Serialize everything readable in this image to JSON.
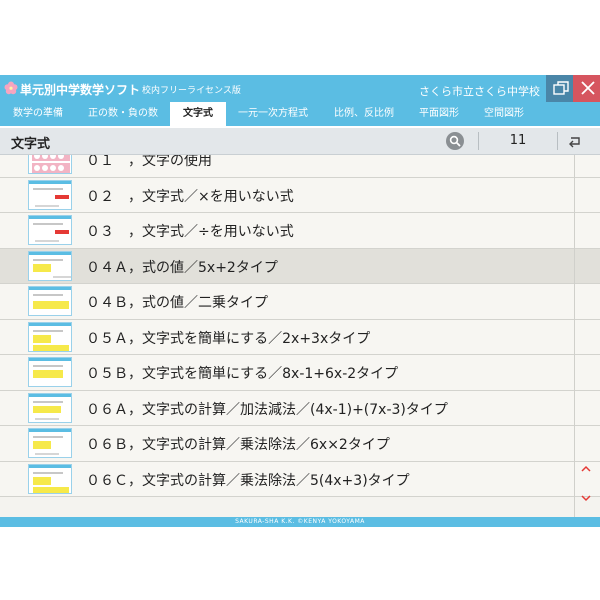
{
  "window": {
    "title": "単元別中学数学ソフト",
    "license": "校内フリーライセンス版",
    "school": "さくら市立さくら中学校",
    "accent": "#5bbde3"
  },
  "tabs": [
    {
      "label": "数学の準備"
    },
    {
      "label": "正の数・負の数"
    },
    {
      "label": "文字式",
      "active": true
    },
    {
      "label": "一元一次方程式"
    },
    {
      "label": "比例、反比例"
    },
    {
      "label": "平面図形"
    },
    {
      "label": "空間図形"
    }
  ],
  "section": {
    "title": "文字式",
    "count": "11",
    "search_icon": "search-icon",
    "back_icon": "return-icon"
  },
  "items": [
    {
      "label": "０１　，文字の使用"
    },
    {
      "label": "０２　，文字式／×を用いない式"
    },
    {
      "label": "０３　，文字式／÷を用いない式"
    },
    {
      "label": "０４Ａ，式の値／5x+2タイプ",
      "selected": true
    },
    {
      "label": "０４Ｂ，式の値／二乗タイプ"
    },
    {
      "label": "０５Ａ，文字式を簡単にする／2x+3xタイプ"
    },
    {
      "label": "０５Ｂ，文字式を簡単にする／8x-1+6x-2タイプ"
    },
    {
      "label": "０６Ａ，文字式の計算／加法減法／(4x-1)+(7x-3)タイプ"
    },
    {
      "label": "０６Ｂ，文字式の計算／乗法除法／6x×2タイプ"
    },
    {
      "label": "０６Ｃ，文字式の計算／乗法除法／5(4x+3)タイプ"
    }
  ],
  "footer": {
    "copyright": "SAKURA-SHA K.K.  ©KENYA YOKOYAMA"
  }
}
